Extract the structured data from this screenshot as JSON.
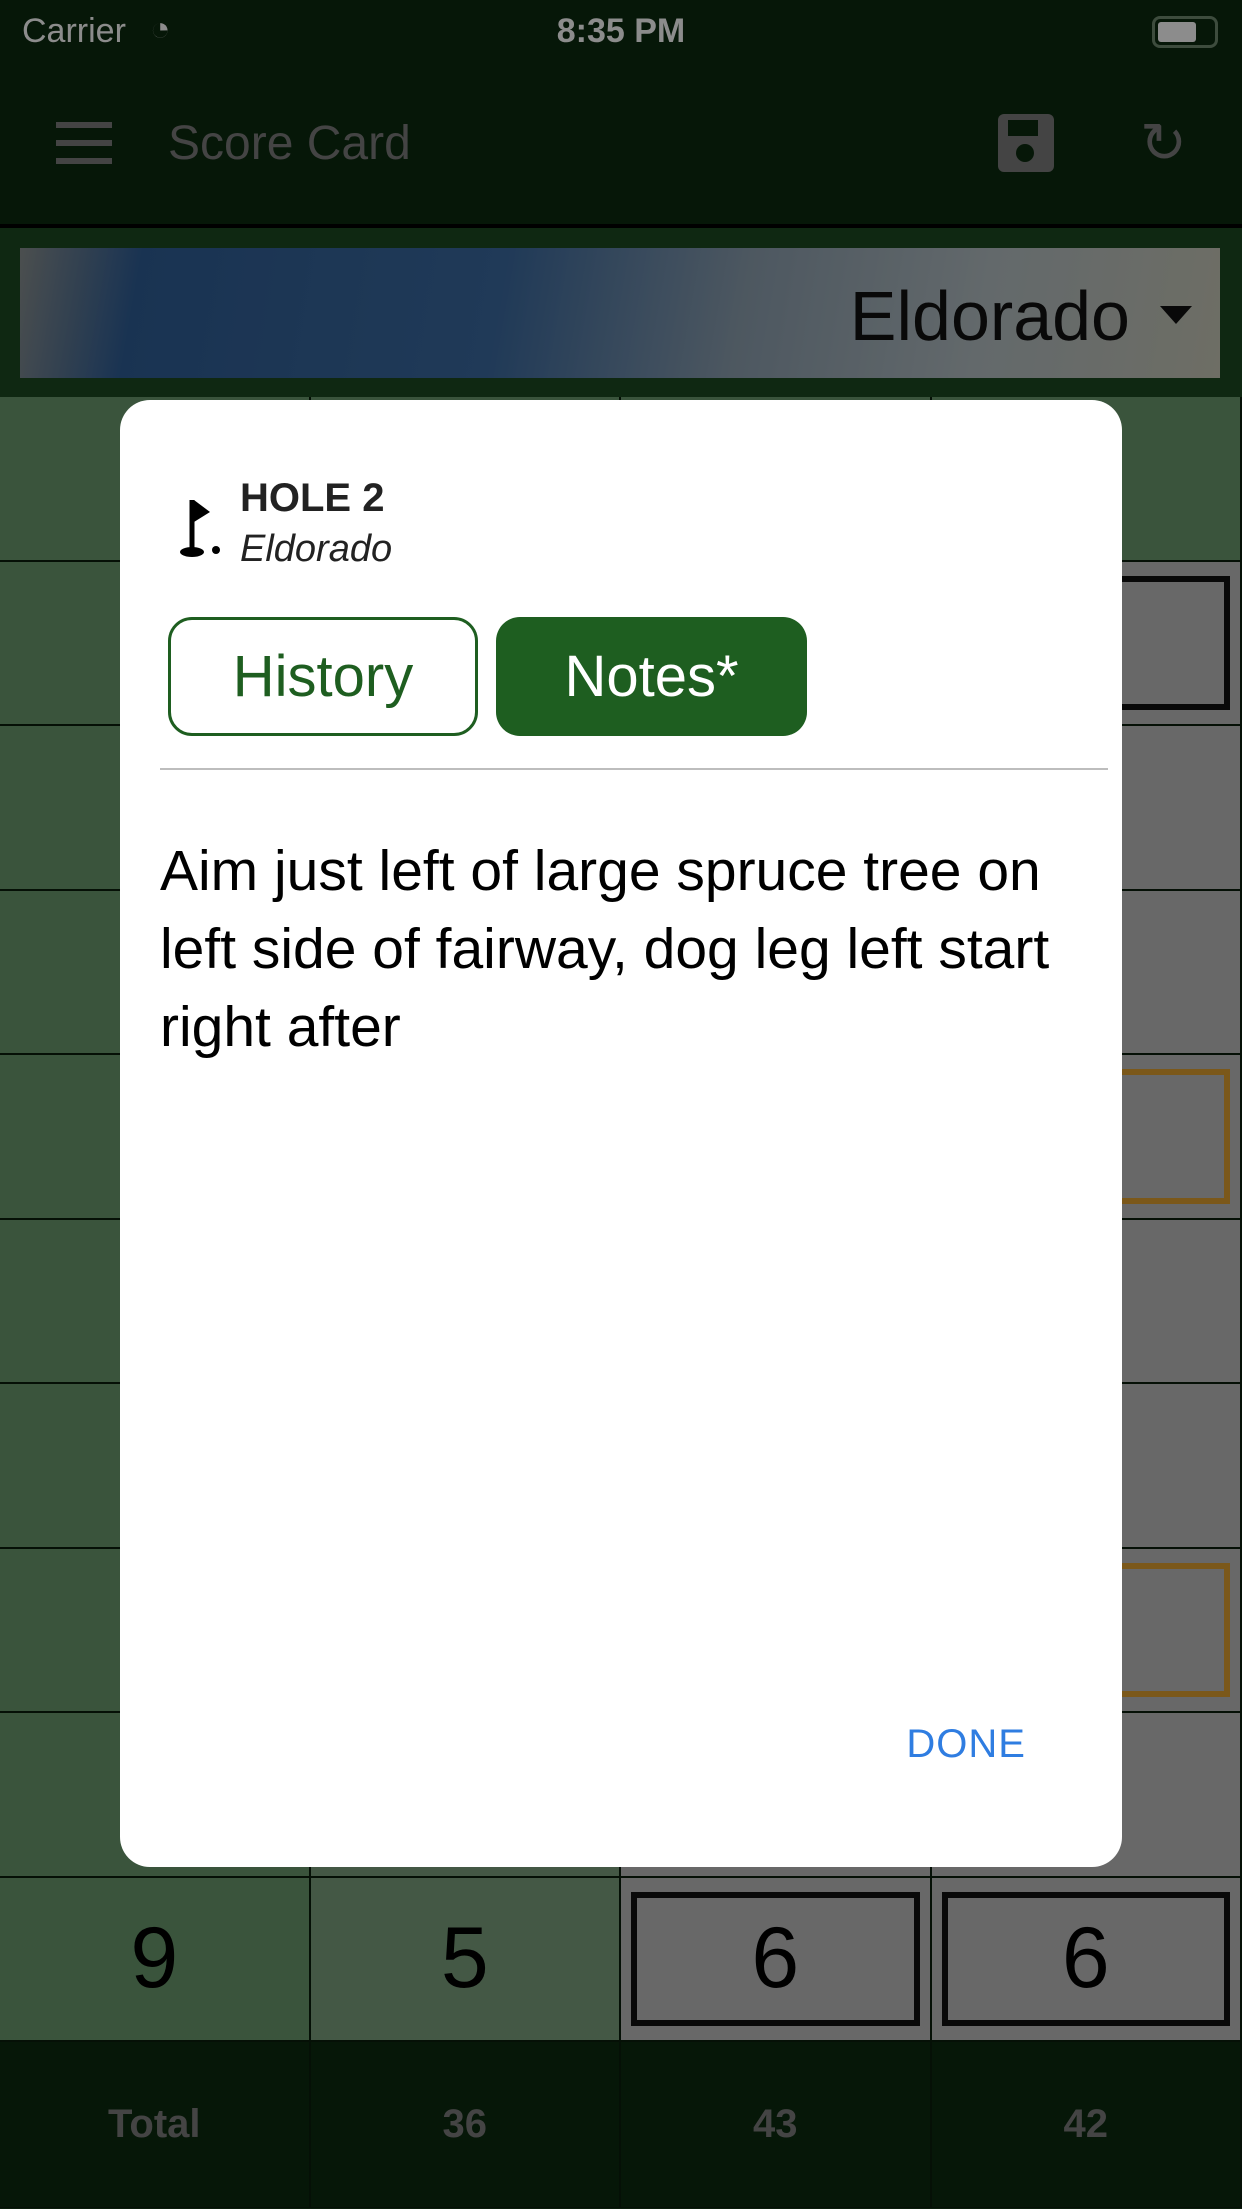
{
  "status_bar": {
    "carrier": "Carrier",
    "time": "8:35 PM",
    "wifi_icon": "wifi-icon",
    "battery_icon": "battery-icon"
  },
  "navbar": {
    "title": "Score Card",
    "menu_icon": "hamburger-menu-icon",
    "save_icon": "floppy-save-icon",
    "refresh_icon": "refresh-icon"
  },
  "course_selector": {
    "value": "Eldorado"
  },
  "scorecard": {
    "last_row": [
      "9",
      "5",
      "6",
      "6"
    ],
    "totals": [
      "Total",
      "36",
      "43",
      "42"
    ]
  },
  "dialog": {
    "hole": "HOLE 2",
    "course": "Eldorado",
    "tabs": [
      {
        "label": "History",
        "active": false
      },
      {
        "label": "Notes*",
        "active": true
      }
    ],
    "notes": "Aim just left of large spruce tree on left side of fairway, dog leg left start right after",
    "done_label": "DONE"
  },
  "colors": {
    "header": "#0c2a0f",
    "accent": "#1e5e20",
    "link": "#2f7de1"
  }
}
